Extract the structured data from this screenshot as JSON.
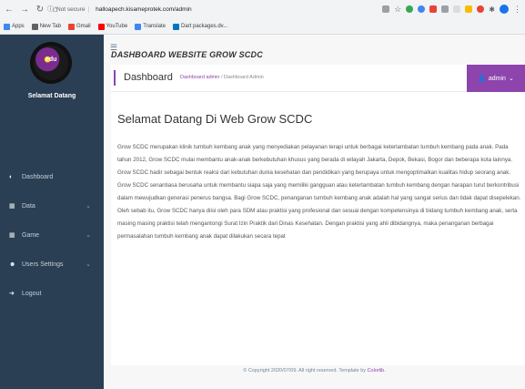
{
  "browser": {
    "security_label": "Not secure",
    "url": "halloapech.kisameprotek.com/admin",
    "bookmarks": [
      {
        "label": "Apps",
        "color": "#4285f4"
      },
      {
        "label": "New Tab",
        "color": "#5f6368"
      },
      {
        "label": "Gmail",
        "color": "#ea4335"
      },
      {
        "label": "YouTube",
        "color": "#ff0000"
      },
      {
        "label": "Translate",
        "color": "#4285f4"
      },
      {
        "label": "Dart packages.dv...",
        "color": "#0175c2"
      }
    ]
  },
  "sidebar": {
    "logo_text": "edu",
    "welcome": "Selamat Datang",
    "items": [
      {
        "label": "Dashboard",
        "icon": "dashboard-icon",
        "has_chevron": false
      },
      {
        "label": "Data",
        "icon": "table-icon",
        "has_chevron": true
      },
      {
        "label": "Game",
        "icon": "table-icon",
        "has_chevron": true
      },
      {
        "label": "Users Settings",
        "icon": "users-icon",
        "has_chevron": true
      },
      {
        "label": "Logout",
        "icon": "logout-icon",
        "has_chevron": false
      }
    ]
  },
  "header": {
    "site_title": "DASHBOARD WEBSITE GROW SCDC",
    "page_title": "Dashboard",
    "breadcrumb_link": "Dashboard admin",
    "breadcrumb_sep": "/",
    "breadcrumb_current": "Dashboard Admin",
    "user_menu": "admin"
  },
  "content": {
    "heading": "Selamat Datang Di Web Grow SCDC",
    "paragraph": "Grow SCDC merupakan klinik tumbuh kembang anak yang menyediakan pelayanan terapi untuk berbagai keterlambatan tumbuh kembang pada anak. Pada tahun 2012, Grow SCDC mulai membantu anak-anak berkebutuhan khusus yang berada di wilayah Jakarta, Depok, Bekasi, Bogor dan beberapa kota lainnya. Grow SCDC hadir sebagai bentuk reaksi dari kebutuhan dunia kesehatan dan pendidikan yang berupaya untuk mengoptimalkan kualitas hidup seorang anak. Grow SCDC senantiasa berusaha untuk membantu siapa saja yang memiliki gangguan atau keterlambatan tumbuh kembang dengan harapan turut berkontribusi dalam mewujudkan generasi penerus bangsa. Bagi Grow SCDC, penanganan tumbuh kembang anak adalah hal yang sangat serius dan tidak dapat disepelekan. Oleh sebab itu, Grow SCDC hanya diisi oleh para SDM atau praktisi yang profesional dan sesuai dengan kompetensinya di bidang tumbuh kembang anak, serta masing masing praktisi telah mengantongi Surat Izin Praktik dari Dinas Kesehatan. Dengan praktisi yang ahli dibidangnya, maka penanganan berbagai permasalahan tumbuh kembang anak dapat dilakukan secara tepat"
  },
  "footer": {
    "text": "© Copyright 2020/07/09. All right reserved. Template by",
    "link": "Colorlib."
  },
  "colors": {
    "sidebar_bg": "#2a3f54",
    "accent": "#8e44ad"
  }
}
